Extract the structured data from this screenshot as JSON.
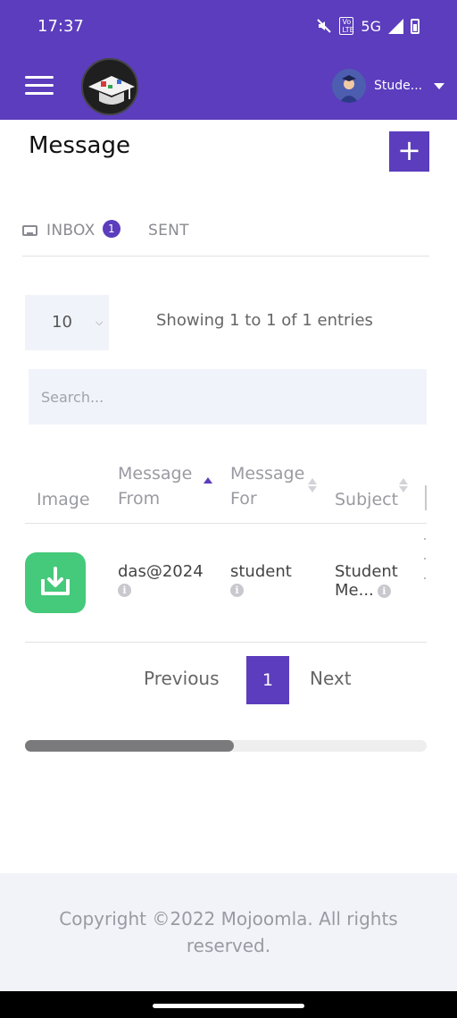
{
  "status_bar": {
    "time": "17:37",
    "network": "5G",
    "volte": "Vo LTE"
  },
  "app_bar": {
    "user_name": "Stude...",
    "colors": {
      "primary": "#5b3dbd"
    }
  },
  "page": {
    "title": "Message",
    "add_label": "+"
  },
  "tabs": {
    "inbox": "INBOX",
    "inbox_count": "1",
    "sent": "SENT"
  },
  "table_controls": {
    "page_length": "10",
    "info": "Showing 1 to 1 of 1 entries",
    "search_placeholder": "Search..."
  },
  "table": {
    "columns": {
      "image": "Image",
      "from_line1": "Message",
      "from_line2": "From",
      "for_line1": "Message",
      "for_line2": "For",
      "subject": "Subject"
    },
    "rows": [
      {
        "from": "das@2024",
        "for": "student",
        "subject_line1": "Student",
        "subject_line2": "Me..."
      }
    ],
    "horizontal_scroll_fraction": 0.52
  },
  "pagination": {
    "previous": "Previous",
    "current": "1",
    "next": "Next"
  },
  "footer": {
    "copyright": "Copyright ©2022 Mojoomla. All rights reserved."
  }
}
